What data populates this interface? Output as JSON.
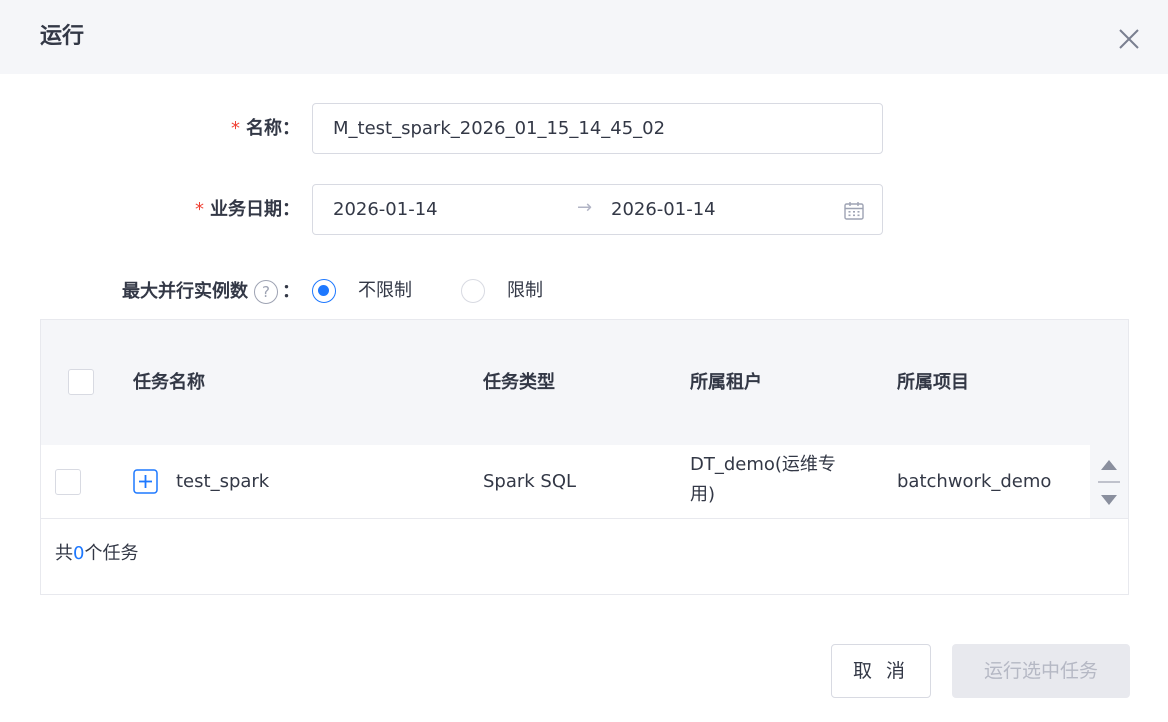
{
  "dialog": {
    "title": "运行",
    "close_icon": "close-icon"
  },
  "form": {
    "name": {
      "required_mark": "*",
      "label": "名称：",
      "value": "M_test_spark_2026_01_15_14_45_02"
    },
    "biz_date": {
      "required_mark": "*",
      "label": "业务日期：",
      "start": "2026-01-14",
      "separator": "→",
      "end": "2026-01-14",
      "icon": "calendar-icon"
    },
    "max_parallel": {
      "label": "最大并行实例数",
      "help": "?",
      "colon": "：",
      "options": [
        {
          "label": "不限制",
          "checked": true
        },
        {
          "label": "限制",
          "checked": false
        }
      ]
    }
  },
  "table": {
    "columns": [
      "任务名称",
      "任务类型",
      "所属租户",
      "所属项目"
    ],
    "rows": [
      {
        "name": "test_spark",
        "type": "Spark SQL",
        "tenant_line1": "DT_demo(运维专",
        "tenant_line2": "用)",
        "project": "batchwork_demo"
      }
    ],
    "footer": {
      "prefix": "共",
      "count": "0",
      "suffix": "个任务"
    }
  },
  "buttons": {
    "cancel": "取 消",
    "run_selected": "运行选中任务"
  },
  "colors": {
    "accent": "#1d78ff",
    "required": "#f04134",
    "header_bg": "#f5f6f9",
    "disabled_bg": "#e8e9ee"
  }
}
